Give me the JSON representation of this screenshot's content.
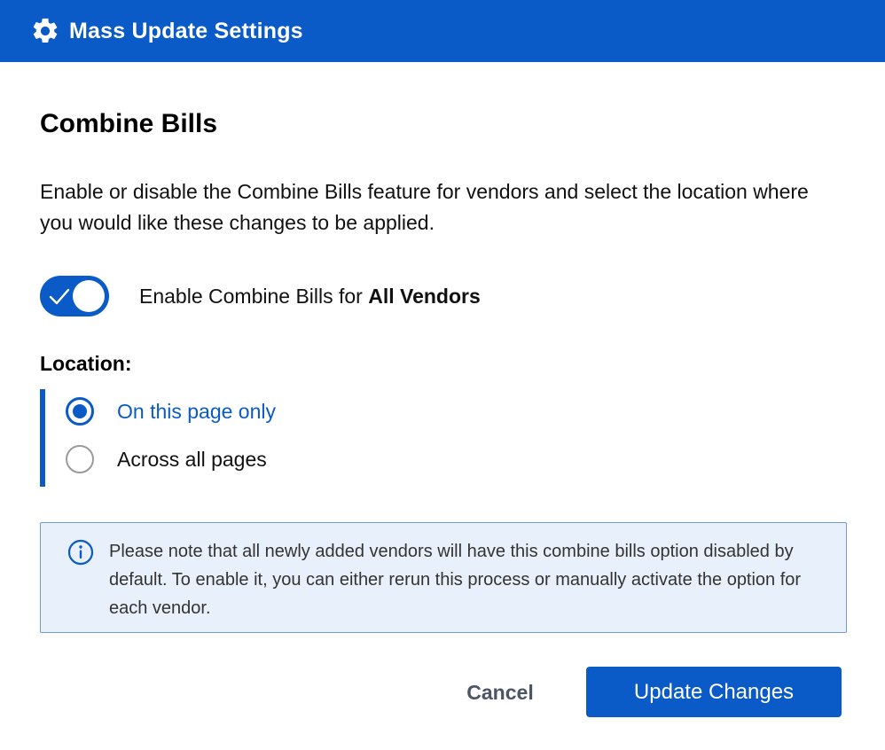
{
  "colors": {
    "primary": "#0a5ac8",
    "notice_background": "#e8f0fb",
    "notice_border": "#6f9bd7",
    "cancel_text": "#4b5565"
  },
  "header": {
    "icon": "gear-icon",
    "title": "Mass Update Settings"
  },
  "section": {
    "title": "Combine Bills",
    "description": "Enable or disable the Combine Bills feature for vendors and select the location where you would like these changes to be applied."
  },
  "toggle": {
    "checked": true,
    "label_prefix": "Enable Combine Bills for ",
    "label_bold": "All Vendors"
  },
  "location": {
    "label": "Location:",
    "options": [
      {
        "label": "On this page only",
        "selected": true
      },
      {
        "label": "Across all pages",
        "selected": false
      }
    ]
  },
  "notice": {
    "icon": "info-icon",
    "text": "Please note that all newly added vendors will have this combine bills option disabled by default. To enable it, you can either rerun this process or manually activate the option for each vendor."
  },
  "footer": {
    "cancel_label": "Cancel",
    "update_label": "Update Changes"
  }
}
